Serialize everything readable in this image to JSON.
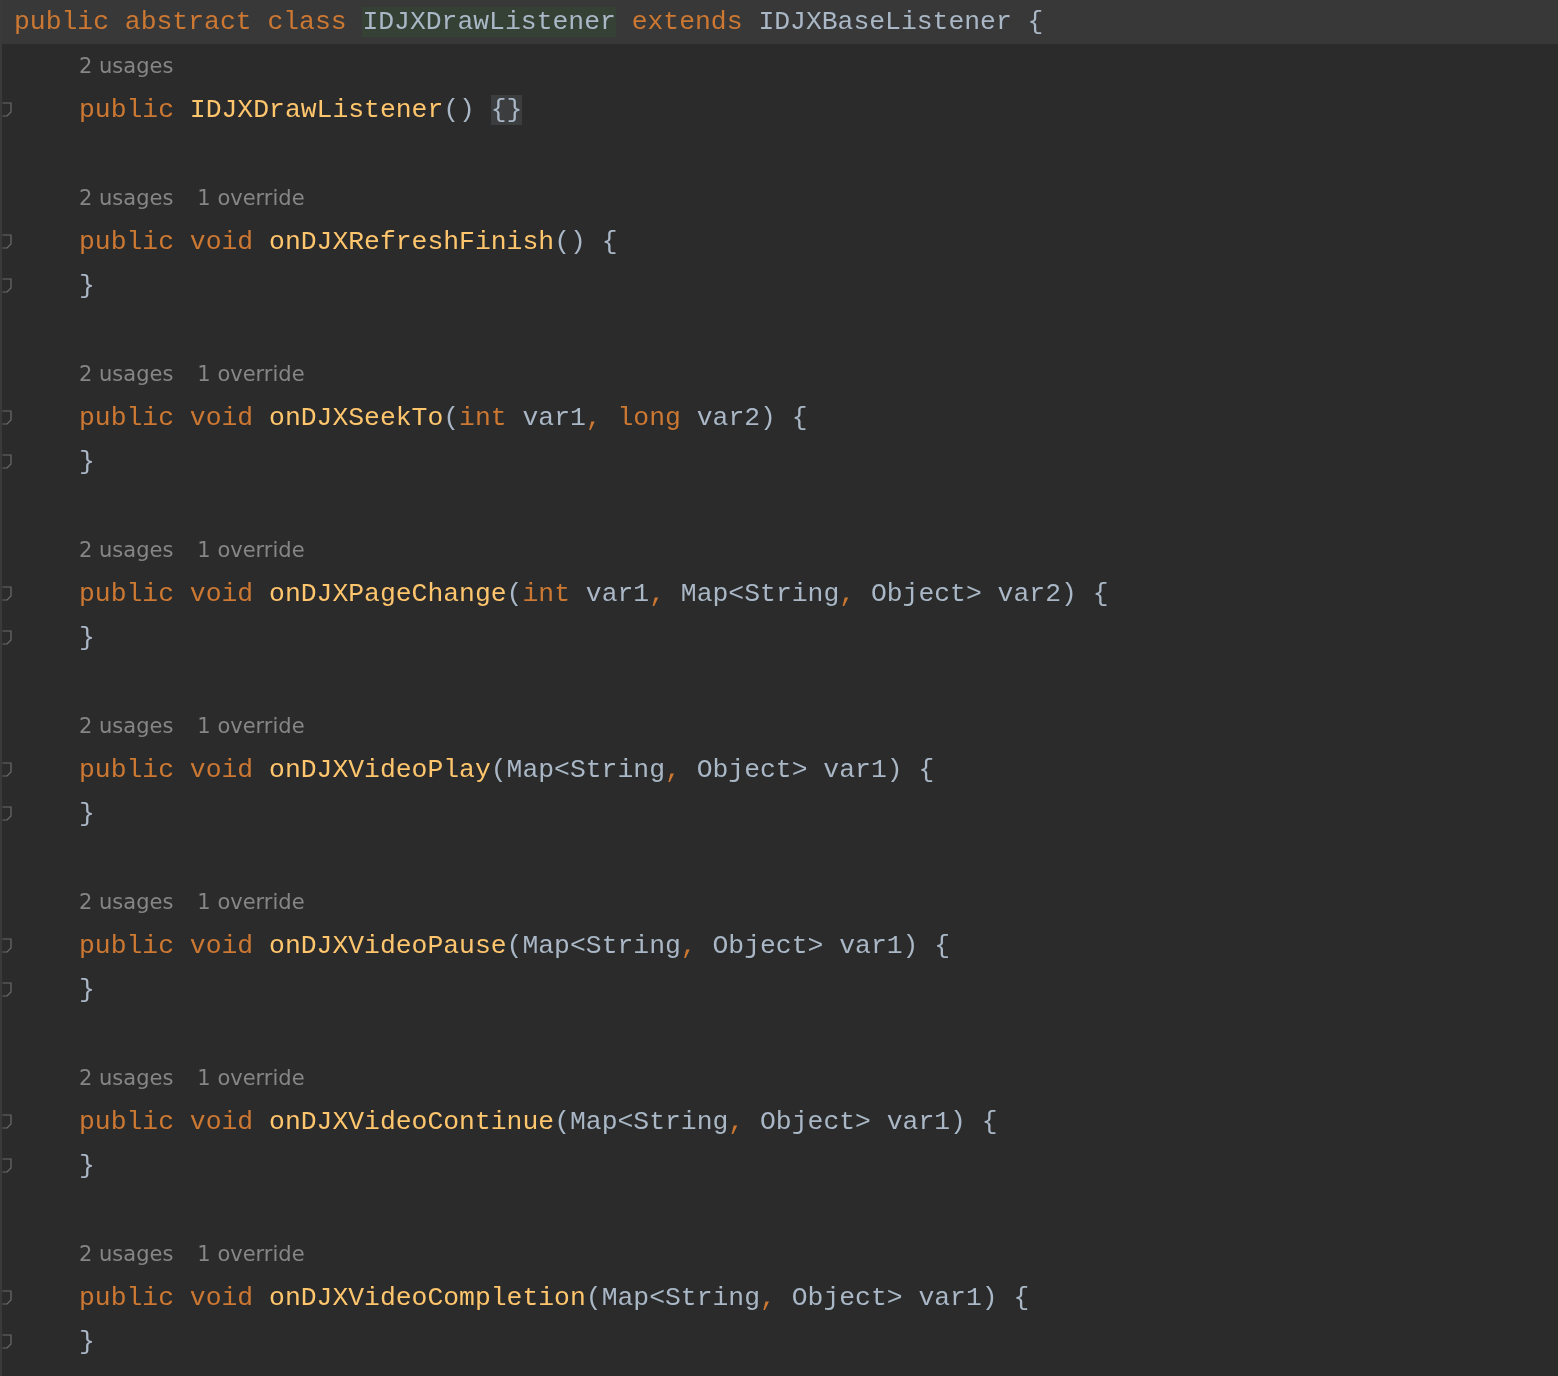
{
  "editor": {
    "lines": [
      {
        "kind": "code",
        "current": true,
        "indent": false,
        "fold": false,
        "tokens": [
          {
            "text": "public abstract class ",
            "kind": "keyword"
          },
          {
            "text": "IDJXDrawListener",
            "kind": "match"
          },
          {
            "text": " extends ",
            "kind": "keyword"
          },
          {
            "text": "IDJXBaseListener {",
            "kind": "plain"
          }
        ]
      },
      {
        "kind": "hint",
        "hints": [
          "2 usages"
        ]
      },
      {
        "kind": "code",
        "current": false,
        "indent": true,
        "fold": true,
        "tokens": [
          {
            "text": "public ",
            "kind": "keyword"
          },
          {
            "text": "IDJXDrawListener",
            "kind": "method"
          },
          {
            "text": "() ",
            "kind": "plain"
          },
          {
            "text": "{}",
            "kind": "folded"
          }
        ]
      },
      {
        "kind": "blank"
      },
      {
        "kind": "hint",
        "hints": [
          "2 usages",
          "1 override"
        ]
      },
      {
        "kind": "code",
        "current": false,
        "indent": true,
        "fold": true,
        "tokens": [
          {
            "text": "public void ",
            "kind": "keyword"
          },
          {
            "text": "onDJXRefreshFinish",
            "kind": "method"
          },
          {
            "text": "() {",
            "kind": "plain"
          }
        ]
      },
      {
        "kind": "code",
        "current": false,
        "indent": true,
        "fold": true,
        "tokens": [
          {
            "text": "}",
            "kind": "plain"
          }
        ]
      },
      {
        "kind": "blank"
      },
      {
        "kind": "hint",
        "hints": [
          "2 usages",
          "1 override"
        ]
      },
      {
        "kind": "code",
        "current": false,
        "indent": true,
        "fold": true,
        "tokens": [
          {
            "text": "public void ",
            "kind": "keyword"
          },
          {
            "text": "onDJXSeekTo",
            "kind": "method"
          },
          {
            "text": "(",
            "kind": "plain"
          },
          {
            "text": "int ",
            "kind": "keyword"
          },
          {
            "text": "var1",
            "kind": "plain"
          },
          {
            "text": ", ",
            "kind": "keyword"
          },
          {
            "text": "long ",
            "kind": "keyword"
          },
          {
            "text": "var2) {",
            "kind": "plain"
          }
        ]
      },
      {
        "kind": "code",
        "current": false,
        "indent": true,
        "fold": true,
        "tokens": [
          {
            "text": "}",
            "kind": "plain"
          }
        ]
      },
      {
        "kind": "blank"
      },
      {
        "kind": "hint",
        "hints": [
          "2 usages",
          "1 override"
        ]
      },
      {
        "kind": "code",
        "current": false,
        "indent": true,
        "fold": true,
        "tokens": [
          {
            "text": "public void ",
            "kind": "keyword"
          },
          {
            "text": "onDJXPageChange",
            "kind": "method"
          },
          {
            "text": "(",
            "kind": "plain"
          },
          {
            "text": "int ",
            "kind": "keyword"
          },
          {
            "text": "var1",
            "kind": "plain"
          },
          {
            "text": ", ",
            "kind": "keyword"
          },
          {
            "text": "Map<String",
            "kind": "plain"
          },
          {
            "text": ", ",
            "kind": "keyword"
          },
          {
            "text": "Object> var2) {",
            "kind": "plain"
          }
        ]
      },
      {
        "kind": "code",
        "current": false,
        "indent": true,
        "fold": true,
        "tokens": [
          {
            "text": "}",
            "kind": "plain"
          }
        ]
      },
      {
        "kind": "blank"
      },
      {
        "kind": "hint",
        "hints": [
          "2 usages",
          "1 override"
        ]
      },
      {
        "kind": "code",
        "current": false,
        "indent": true,
        "fold": true,
        "tokens": [
          {
            "text": "public void ",
            "kind": "keyword"
          },
          {
            "text": "onDJXVideoPlay",
            "kind": "method"
          },
          {
            "text": "(Map<String",
            "kind": "plain"
          },
          {
            "text": ", ",
            "kind": "keyword"
          },
          {
            "text": "Object> var1) {",
            "kind": "plain"
          }
        ]
      },
      {
        "kind": "code",
        "current": false,
        "indent": true,
        "fold": true,
        "tokens": [
          {
            "text": "}",
            "kind": "plain"
          }
        ]
      },
      {
        "kind": "blank"
      },
      {
        "kind": "hint",
        "hints": [
          "2 usages",
          "1 override"
        ]
      },
      {
        "kind": "code",
        "current": false,
        "indent": true,
        "fold": true,
        "tokens": [
          {
            "text": "public void ",
            "kind": "keyword"
          },
          {
            "text": "onDJXVideoPause",
            "kind": "method"
          },
          {
            "text": "(Map<String",
            "kind": "plain"
          },
          {
            "text": ", ",
            "kind": "keyword"
          },
          {
            "text": "Object> var1) {",
            "kind": "plain"
          }
        ]
      },
      {
        "kind": "code",
        "current": false,
        "indent": true,
        "fold": true,
        "tokens": [
          {
            "text": "}",
            "kind": "plain"
          }
        ]
      },
      {
        "kind": "blank"
      },
      {
        "kind": "hint",
        "hints": [
          "2 usages",
          "1 override"
        ]
      },
      {
        "kind": "code",
        "current": false,
        "indent": true,
        "fold": true,
        "tokens": [
          {
            "text": "public void ",
            "kind": "keyword"
          },
          {
            "text": "onDJXVideoContinue",
            "kind": "method"
          },
          {
            "text": "(Map<String",
            "kind": "plain"
          },
          {
            "text": ", ",
            "kind": "keyword"
          },
          {
            "text": "Object> var1) {",
            "kind": "plain"
          }
        ]
      },
      {
        "kind": "code",
        "current": false,
        "indent": true,
        "fold": true,
        "tokens": [
          {
            "text": "}",
            "kind": "plain"
          }
        ]
      },
      {
        "kind": "blank"
      },
      {
        "kind": "hint",
        "hints": [
          "2 usages",
          "1 override"
        ]
      },
      {
        "kind": "code",
        "current": false,
        "indent": true,
        "fold": true,
        "tokens": [
          {
            "text": "public void ",
            "kind": "keyword"
          },
          {
            "text": "onDJXVideoCompletion",
            "kind": "method"
          },
          {
            "text": "(Map<String",
            "kind": "plain"
          },
          {
            "text": ", ",
            "kind": "keyword"
          },
          {
            "text": "Object> var1) {",
            "kind": "plain"
          }
        ]
      },
      {
        "kind": "code",
        "current": false,
        "indent": true,
        "fold": true,
        "tokens": [
          {
            "text": "}",
            "kind": "plain"
          }
        ]
      }
    ]
  }
}
